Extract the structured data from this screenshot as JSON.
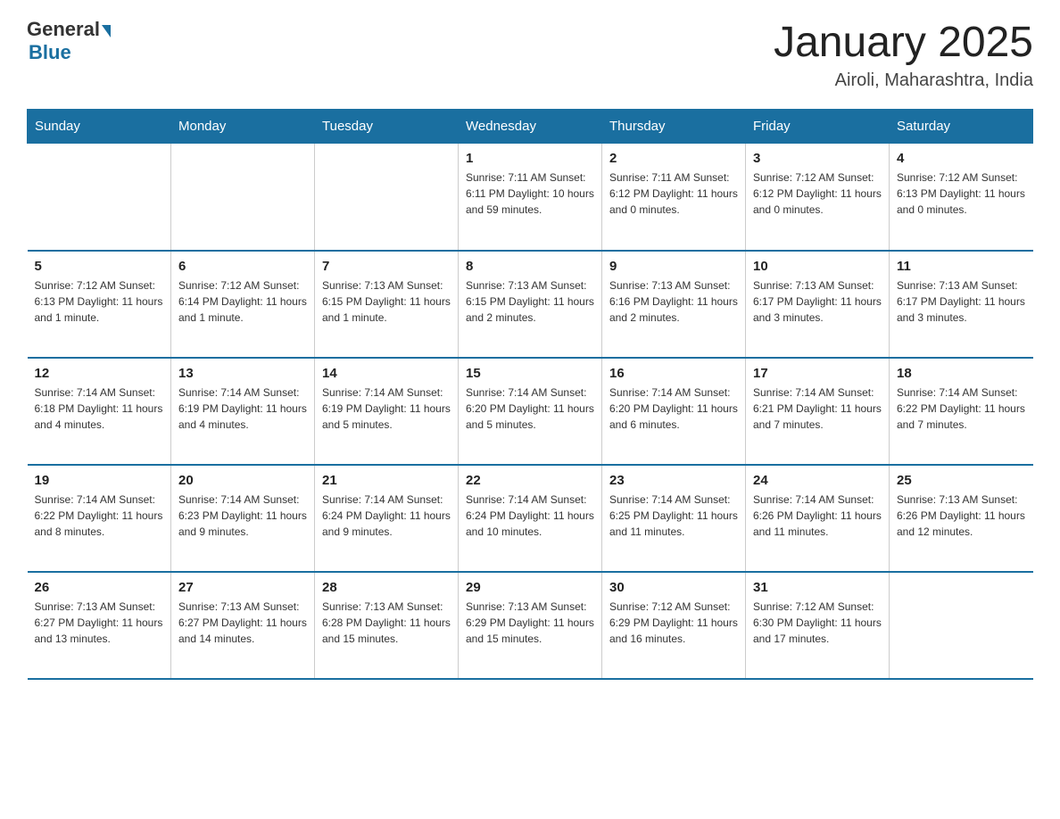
{
  "header": {
    "logo": {
      "general": "General",
      "blue": "Blue"
    },
    "title": "January 2025",
    "subtitle": "Airoli, Maharashtra, India"
  },
  "weekdays": [
    "Sunday",
    "Monday",
    "Tuesday",
    "Wednesday",
    "Thursday",
    "Friday",
    "Saturday"
  ],
  "weeks": [
    [
      {
        "day": "",
        "info": ""
      },
      {
        "day": "",
        "info": ""
      },
      {
        "day": "",
        "info": ""
      },
      {
        "day": "1",
        "info": "Sunrise: 7:11 AM\nSunset: 6:11 PM\nDaylight: 10 hours\nand 59 minutes."
      },
      {
        "day": "2",
        "info": "Sunrise: 7:11 AM\nSunset: 6:12 PM\nDaylight: 11 hours\nand 0 minutes."
      },
      {
        "day": "3",
        "info": "Sunrise: 7:12 AM\nSunset: 6:12 PM\nDaylight: 11 hours\nand 0 minutes."
      },
      {
        "day": "4",
        "info": "Sunrise: 7:12 AM\nSunset: 6:13 PM\nDaylight: 11 hours\nand 0 minutes."
      }
    ],
    [
      {
        "day": "5",
        "info": "Sunrise: 7:12 AM\nSunset: 6:13 PM\nDaylight: 11 hours\nand 1 minute."
      },
      {
        "day": "6",
        "info": "Sunrise: 7:12 AM\nSunset: 6:14 PM\nDaylight: 11 hours\nand 1 minute."
      },
      {
        "day": "7",
        "info": "Sunrise: 7:13 AM\nSunset: 6:15 PM\nDaylight: 11 hours\nand 1 minute."
      },
      {
        "day": "8",
        "info": "Sunrise: 7:13 AM\nSunset: 6:15 PM\nDaylight: 11 hours\nand 2 minutes."
      },
      {
        "day": "9",
        "info": "Sunrise: 7:13 AM\nSunset: 6:16 PM\nDaylight: 11 hours\nand 2 minutes."
      },
      {
        "day": "10",
        "info": "Sunrise: 7:13 AM\nSunset: 6:17 PM\nDaylight: 11 hours\nand 3 minutes."
      },
      {
        "day": "11",
        "info": "Sunrise: 7:13 AM\nSunset: 6:17 PM\nDaylight: 11 hours\nand 3 minutes."
      }
    ],
    [
      {
        "day": "12",
        "info": "Sunrise: 7:14 AM\nSunset: 6:18 PM\nDaylight: 11 hours\nand 4 minutes."
      },
      {
        "day": "13",
        "info": "Sunrise: 7:14 AM\nSunset: 6:19 PM\nDaylight: 11 hours\nand 4 minutes."
      },
      {
        "day": "14",
        "info": "Sunrise: 7:14 AM\nSunset: 6:19 PM\nDaylight: 11 hours\nand 5 minutes."
      },
      {
        "day": "15",
        "info": "Sunrise: 7:14 AM\nSunset: 6:20 PM\nDaylight: 11 hours\nand 5 minutes."
      },
      {
        "day": "16",
        "info": "Sunrise: 7:14 AM\nSunset: 6:20 PM\nDaylight: 11 hours\nand 6 minutes."
      },
      {
        "day": "17",
        "info": "Sunrise: 7:14 AM\nSunset: 6:21 PM\nDaylight: 11 hours\nand 7 minutes."
      },
      {
        "day": "18",
        "info": "Sunrise: 7:14 AM\nSunset: 6:22 PM\nDaylight: 11 hours\nand 7 minutes."
      }
    ],
    [
      {
        "day": "19",
        "info": "Sunrise: 7:14 AM\nSunset: 6:22 PM\nDaylight: 11 hours\nand 8 minutes."
      },
      {
        "day": "20",
        "info": "Sunrise: 7:14 AM\nSunset: 6:23 PM\nDaylight: 11 hours\nand 9 minutes."
      },
      {
        "day": "21",
        "info": "Sunrise: 7:14 AM\nSunset: 6:24 PM\nDaylight: 11 hours\nand 9 minutes."
      },
      {
        "day": "22",
        "info": "Sunrise: 7:14 AM\nSunset: 6:24 PM\nDaylight: 11 hours\nand 10 minutes."
      },
      {
        "day": "23",
        "info": "Sunrise: 7:14 AM\nSunset: 6:25 PM\nDaylight: 11 hours\nand 11 minutes."
      },
      {
        "day": "24",
        "info": "Sunrise: 7:14 AM\nSunset: 6:26 PM\nDaylight: 11 hours\nand 11 minutes."
      },
      {
        "day": "25",
        "info": "Sunrise: 7:13 AM\nSunset: 6:26 PM\nDaylight: 11 hours\nand 12 minutes."
      }
    ],
    [
      {
        "day": "26",
        "info": "Sunrise: 7:13 AM\nSunset: 6:27 PM\nDaylight: 11 hours\nand 13 minutes."
      },
      {
        "day": "27",
        "info": "Sunrise: 7:13 AM\nSunset: 6:27 PM\nDaylight: 11 hours\nand 14 minutes."
      },
      {
        "day": "28",
        "info": "Sunrise: 7:13 AM\nSunset: 6:28 PM\nDaylight: 11 hours\nand 15 minutes."
      },
      {
        "day": "29",
        "info": "Sunrise: 7:13 AM\nSunset: 6:29 PM\nDaylight: 11 hours\nand 15 minutes."
      },
      {
        "day": "30",
        "info": "Sunrise: 7:12 AM\nSunset: 6:29 PM\nDaylight: 11 hours\nand 16 minutes."
      },
      {
        "day": "31",
        "info": "Sunrise: 7:12 AM\nSunset: 6:30 PM\nDaylight: 11 hours\nand 17 minutes."
      },
      {
        "day": "",
        "info": ""
      }
    ]
  ]
}
